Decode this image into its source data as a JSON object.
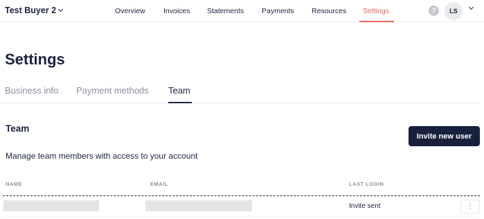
{
  "account": {
    "name": "Test Buyer 2"
  },
  "nav": {
    "items": [
      {
        "label": "Overview",
        "active": false
      },
      {
        "label": "Invoices",
        "active": false
      },
      {
        "label": "Statements",
        "active": false
      },
      {
        "label": "Payments",
        "active": false
      },
      {
        "label": "Resources",
        "active": false
      },
      {
        "label": "Settings",
        "active": true
      }
    ],
    "active_color": "#e8655a"
  },
  "user": {
    "initials": "LS",
    "help_symbol": "?"
  },
  "page": {
    "title": "Settings"
  },
  "tabs": [
    {
      "label": "Business info",
      "active": false
    },
    {
      "label": "Payment methods",
      "active": false
    },
    {
      "label": "Team",
      "active": true
    }
  ],
  "team": {
    "title": "Team",
    "description": "Manage team members with access to your account",
    "invite_button": "Invite new user",
    "columns": {
      "name": "NAME",
      "email": "EMAIL",
      "last_login": "LAST LOGIN"
    },
    "rows": [
      {
        "name": "",
        "email": "",
        "last_login": "Invite sent",
        "name_redacted": true,
        "email_redacted": true
      }
    ]
  },
  "icons": {
    "kebab": "more-vertical-icon",
    "help": "help-icon",
    "chevron": "chevron-down-icon"
  },
  "colors": {
    "primary_button": "#17203d",
    "text": "#1b2340",
    "muted": "#8a90a2"
  }
}
